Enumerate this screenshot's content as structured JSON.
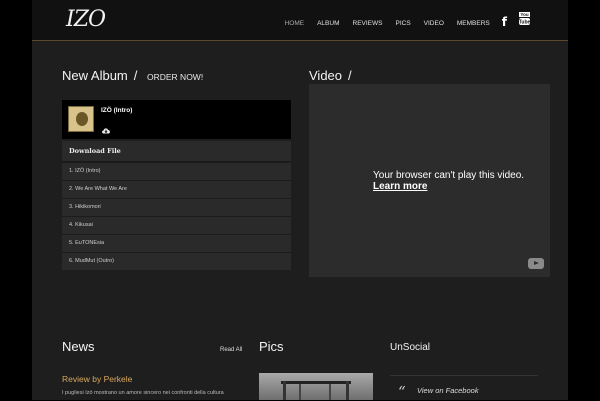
{
  "header": {
    "logo": "IZO",
    "nav": [
      "HOME",
      "ALBUM",
      "REVIEWS",
      "PICS",
      "VIDEO",
      "MEMBERS"
    ],
    "social_icons": [
      "facebook-icon",
      "youtube-icon"
    ]
  },
  "album": {
    "title": "New Album",
    "subtitle": "ORDER NOW!",
    "current_track": "IZÖ (Intro)",
    "download_label": "Download File",
    "tracks": [
      "1. IZÖ (Intro)",
      "2. We Are What We Are",
      "3. Hikikomori",
      "4. Kikusai",
      "5. EuTONEsia",
      "6. MudMut (Outro)"
    ]
  },
  "video": {
    "title": "Video",
    "message": "Your browser can't play this video.",
    "link": "Learn more"
  },
  "news": {
    "title": "News",
    "read_all": "Read All",
    "review_title": "Review by Perkele",
    "review_text": "I pugliesi Izö mostrano un amore sincero nei confronti della cultura"
  },
  "pics": {
    "title": "Pics"
  },
  "unsocial": {
    "title": "UnSocial",
    "link": "View on Facebook"
  },
  "colors": {
    "accent": "#d8a85e",
    "background": "#1e1e1e",
    "header": "#111111"
  }
}
